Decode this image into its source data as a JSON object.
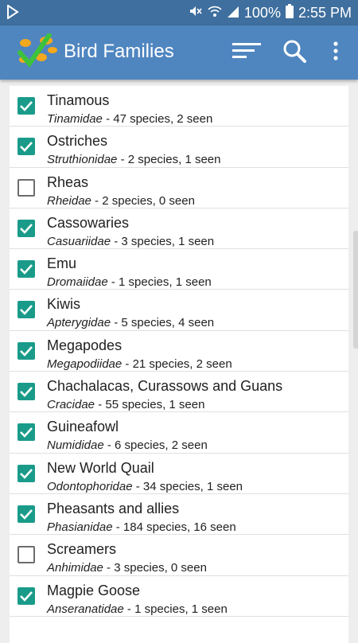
{
  "status": {
    "battery": "100%",
    "time": "2:55 PM"
  },
  "app_bar": {
    "title": "Bird Families"
  },
  "families": [
    {
      "name": "Tinamous",
      "latin": "Tinamidae",
      "counts": " - 47 species, 2 seen",
      "checked": true
    },
    {
      "name": "Ostriches",
      "latin": "Struthionidae",
      "counts": " - 2 species, 1 seen",
      "checked": true
    },
    {
      "name": "Rheas",
      "latin": "Rheidae",
      "counts": " - 2 species, 0 seen",
      "checked": false
    },
    {
      "name": "Cassowaries",
      "latin": "Casuariidae",
      "counts": " - 3 species, 1 seen",
      "checked": true
    },
    {
      "name": "Emu",
      "latin": "Dromaiidae",
      "counts": " - 1 species, 1 seen",
      "checked": true
    },
    {
      "name": "Kiwis",
      "latin": "Apterygidae",
      "counts": " - 5 species, 4 seen",
      "checked": true
    },
    {
      "name": "Megapodes",
      "latin": "Megapodiidae",
      "counts": " - 21 species, 2 seen",
      "checked": true
    },
    {
      "name": "Chachalacas, Curassows and Guans",
      "latin": "Cracidae",
      "counts": " - 55 species, 1 seen",
      "checked": true
    },
    {
      "name": "Guineafowl",
      "latin": "Numididae",
      "counts": " - 6 species, 2 seen",
      "checked": true
    },
    {
      "name": "New World Quail",
      "latin": "Odontophoridae",
      "counts": " - 34 species, 1 seen",
      "checked": true
    },
    {
      "name": "Pheasants and allies",
      "latin": "Phasianidae",
      "counts": " - 184 species, 16 seen",
      "checked": true
    },
    {
      "name": "Screamers",
      "latin": "Anhimidae",
      "counts": " - 3 species, 0 seen",
      "checked": false
    },
    {
      "name": "Magpie Goose",
      "latin": "Anseranatidae",
      "counts": " - 1 species, 1 seen",
      "checked": true
    }
  ],
  "icons": {
    "status_left": "play-store-notification-icon",
    "mute": "mute-icon",
    "wifi": "wifi-icon",
    "signal": "signal-icon",
    "battery": "battery-icon",
    "logo": "app-logo-icon",
    "sort": "sort-icon",
    "search": "search-icon",
    "overflow": "more-vert-icon"
  },
  "colors": {
    "status_bar": "#3f6f9e",
    "app_bar": "#4f86c0",
    "checkbox": "#1a9b8a"
  }
}
